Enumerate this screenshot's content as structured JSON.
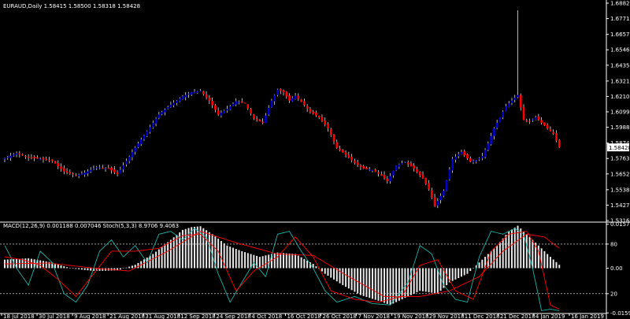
{
  "chart_data": [
    {
      "type": "candlestick",
      "title": "EURAUD,Daily  1.58415 1.58500 1.58318 1.58428",
      "y_ticks": [
        "1.68820",
        "1.67710",
        "1.66570",
        "1.65460",
        "1.64350",
        "1.63210",
        "1.62100",
        "1.60990",
        "1.59880",
        "1.58740",
        "1.57630",
        "1.56520",
        "1.55380",
        "1.54270",
        "1.53160"
      ],
      "ylim": [
        1.5316,
        1.6882
      ],
      "x_ticks": [
        "18 Jul 2018",
        "30 Jul 2018",
        "9 Aug 2018",
        "21 Aug 2018",
        "31 Aug 2018",
        "12 Sep 2018",
        "24 Sep 2018",
        "4 Oct 2018",
        "16 Oct 2018",
        "26 Oct 2018",
        "7 Nov 2018",
        "19 Nov 2018",
        "29 Nov 2018",
        "11 Dec 2018",
        "21 Dec 2018",
        "4 Jan 2019",
        "16 Jan 2019"
      ],
      "current_price": "1.58428",
      "colors": {
        "bull": "#0000cd",
        "bear": "#ff0000",
        "wick": "#ffffff"
      },
      "close_path": [
        [
          0,
          1.5765
        ],
        [
          4,
          1.58
        ],
        [
          8,
          1.577
        ],
        [
          12,
          1.576
        ],
        [
          16,
          1.5745
        ],
        [
          20,
          1.567
        ],
        [
          24,
          1.564
        ],
        [
          27,
          1.566
        ],
        [
          31,
          1.57
        ],
        [
          35,
          1.569
        ],
        [
          38,
          1.565
        ],
        [
          44,
          1.584
        ],
        [
          48,
          1.596
        ],
        [
          52,
          1.608
        ],
        [
          56,
          1.615
        ],
        [
          60,
          1.621
        ],
        [
          63,
          1.624
        ],
        [
          66,
          1.625
        ],
        [
          69,
          1.618
        ],
        [
          72,
          1.608
        ],
        [
          75,
          1.612
        ],
        [
          78,
          1.6175
        ],
        [
          81,
          1.616
        ],
        [
          84,
          1.605
        ],
        [
          87,
          1.602
        ],
        [
          90,
          1.618
        ],
        [
          92,
          1.626
        ],
        [
          94,
          1.624
        ],
        [
          96,
          1.618
        ],
        [
          98,
          1.6215
        ],
        [
          100,
          1.617
        ],
        [
          103,
          1.61
        ],
        [
          106,
          1.606
        ],
        [
          109,
          1.598
        ],
        [
          112,
          1.584
        ],
        [
          115,
          1.579
        ],
        [
          118,
          1.573
        ],
        [
          121,
          1.569
        ],
        [
          124,
          1.568
        ],
        [
          127,
          1.564
        ],
        [
          129,
          1.56
        ],
        [
          132,
          1.571
        ],
        [
          135,
          1.574
        ],
        [
          138,
          1.569
        ],
        [
          141,
          1.562
        ],
        [
          143,
          1.554
        ],
        [
          145,
          1.542
        ],
        [
          148,
          1.553
        ],
        [
          151,
          1.576
        ],
        [
          154,
          1.581
        ],
        [
          157,
          1.574
        ],
        [
          159,
          1.575
        ],
        [
          161,
          1.578
        ],
        [
          163,
          1.587
        ],
        [
          165,
          1.598
        ],
        [
          167,
          1.606
        ],
        [
          169,
          1.614
        ],
        [
          171,
          1.618
        ],
        [
          173,
          1.622
        ],
        [
          175,
          1.604
        ],
        [
          177,
          1.603
        ],
        [
          179,
          1.606
        ],
        [
          181,
          1.602
        ],
        [
          183,
          1.598
        ],
        [
          185,
          1.594
        ],
        [
          187,
          1.5843
        ]
      ],
      "spike": {
        "index": 173,
        "high": 1.683
      }
    },
    {
      "type": "line",
      "title": "MACD(12,26,9) 0.001188 0.007046  Stoch(5,3,3) 8.9706 9.4063",
      "y_ticks_right": [
        "0.015738",
        "80",
        "0.00",
        "20",
        "-0.015965"
      ],
      "macd_hist": [
        [
          0,
          0.003
        ],
        [
          8,
          0.0035
        ],
        [
          16,
          0.002
        ],
        [
          22,
          0.0
        ],
        [
          30,
          -0.001
        ],
        [
          38,
          -0.0008
        ],
        [
          44,
          0.0012
        ],
        [
          50,
          0.005
        ],
        [
          56,
          0.01
        ],
        [
          60,
          0.0135
        ],
        [
          63,
          0.0145
        ],
        [
          66,
          0.0148
        ],
        [
          70,
          0.012
        ],
        [
          75,
          0.008
        ],
        [
          80,
          0.006
        ],
        [
          86,
          0.004
        ],
        [
          92,
          0.0055
        ],
        [
          98,
          0.005
        ],
        [
          104,
          0.0015
        ],
        [
          108,
          -0.002
        ],
        [
          114,
          -0.006
        ],
        [
          120,
          -0.0095
        ],
        [
          126,
          -0.0115
        ],
        [
          130,
          -0.013
        ],
        [
          134,
          -0.011
        ],
        [
          140,
          -0.008
        ],
        [
          146,
          -0.009
        ],
        [
          150,
          -0.005
        ],
        [
          156,
          -0.002
        ],
        [
          160,
          0.002
        ],
        [
          166,
          0.008
        ],
        [
          170,
          0.013
        ],
        [
          173,
          0.015
        ],
        [
          176,
          0.012
        ],
        [
          180,
          0.008
        ],
        [
          184,
          0.004
        ],
        [
          187,
          0.0012
        ]
      ],
      "macd_signal": [
        [
          0,
          0.0015
        ],
        [
          15,
          0.0018
        ],
        [
          30,
          0.0
        ],
        [
          42,
          -0.001
        ],
        [
          55,
          0.006
        ],
        [
          66,
          0.013
        ],
        [
          78,
          0.009
        ],
        [
          92,
          0.005
        ],
        [
          104,
          0.0045
        ],
        [
          116,
          -0.003
        ],
        [
          128,
          -0.01
        ],
        [
          140,
          -0.01
        ],
        [
          150,
          -0.008
        ],
        [
          160,
          -0.003
        ],
        [
          168,
          0.006
        ],
        [
          176,
          0.012
        ],
        [
          182,
          0.011
        ],
        [
          187,
          0.007
        ]
      ],
      "stoch_k": [
        [
          0,
          0.008
        ],
        [
          4,
          0.0
        ],
        [
          8,
          -0.006
        ],
        [
          12,
          0.006
        ],
        [
          16,
          0.002
        ],
        [
          20,
          -0.009
        ],
        [
          24,
          -0.012
        ],
        [
          28,
          -0.006
        ],
        [
          32,
          0.006
        ],
        [
          36,
          0.01
        ],
        [
          40,
          0.004
        ],
        [
          44,
          0.008
        ],
        [
          48,
          0.002
        ],
        [
          52,
          0.012
        ],
        [
          56,
          0.013
        ],
        [
          60,
          0.01
        ],
        [
          64,
          0.014
        ],
        [
          68,
          0.011
        ],
        [
          72,
          -0.002
        ],
        [
          76,
          -0.012
        ],
        [
          80,
          -0.005
        ],
        [
          84,
          0.002
        ],
        [
          88,
          -0.003
        ],
        [
          92,
          0.012
        ],
        [
          96,
          0.013
        ],
        [
          100,
          0.006
        ],
        [
          104,
          0.0
        ],
        [
          108,
          -0.008
        ],
        [
          112,
          -0.012
        ],
        [
          118,
          -0.01
        ],
        [
          124,
          -0.0125
        ],
        [
          130,
          -0.013
        ],
        [
          136,
          -0.005
        ],
        [
          140,
          0.008
        ],
        [
          144,
          0.005
        ],
        [
          148,
          -0.006
        ],
        [
          152,
          -0.011
        ],
        [
          156,
          -0.012
        ],
        [
          160,
          0.004
        ],
        [
          164,
          0.013
        ],
        [
          168,
          0.012
        ],
        [
          172,
          0.014
        ],
        [
          175,
          0.012
        ],
        [
          178,
          0.0
        ],
        [
          181,
          -0.015
        ],
        [
          184,
          -0.0145
        ],
        [
          187,
          -0.015
        ]
      ],
      "stoch_d": [
        [
          0,
          0.004
        ],
        [
          6,
          0.003
        ],
        [
          12,
          0.001
        ],
        [
          18,
          -0.004
        ],
        [
          24,
          -0.01
        ],
        [
          30,
          -0.002
        ],
        [
          36,
          0.006
        ],
        [
          44,
          0.006
        ],
        [
          52,
          0.007
        ],
        [
          60,
          0.0115
        ],
        [
          66,
          0.012
        ],
        [
          72,
          0.006
        ],
        [
          78,
          -0.008
        ],
        [
          84,
          -0.001
        ],
        [
          92,
          0.004
        ],
        [
          98,
          0.011
        ],
        [
          104,
          0.004
        ],
        [
          110,
          -0.008
        ],
        [
          118,
          -0.011
        ],
        [
          126,
          -0.012
        ],
        [
          134,
          -0.01
        ],
        [
          140,
          0.001
        ],
        [
          146,
          0.003
        ],
        [
          152,
          -0.008
        ],
        [
          158,
          -0.011
        ],
        [
          164,
          0.006
        ],
        [
          170,
          0.012
        ],
        [
          176,
          0.013
        ],
        [
          180,
          0.006
        ],
        [
          184,
          -0.013
        ],
        [
          187,
          -0.0145
        ]
      ]
    }
  ]
}
